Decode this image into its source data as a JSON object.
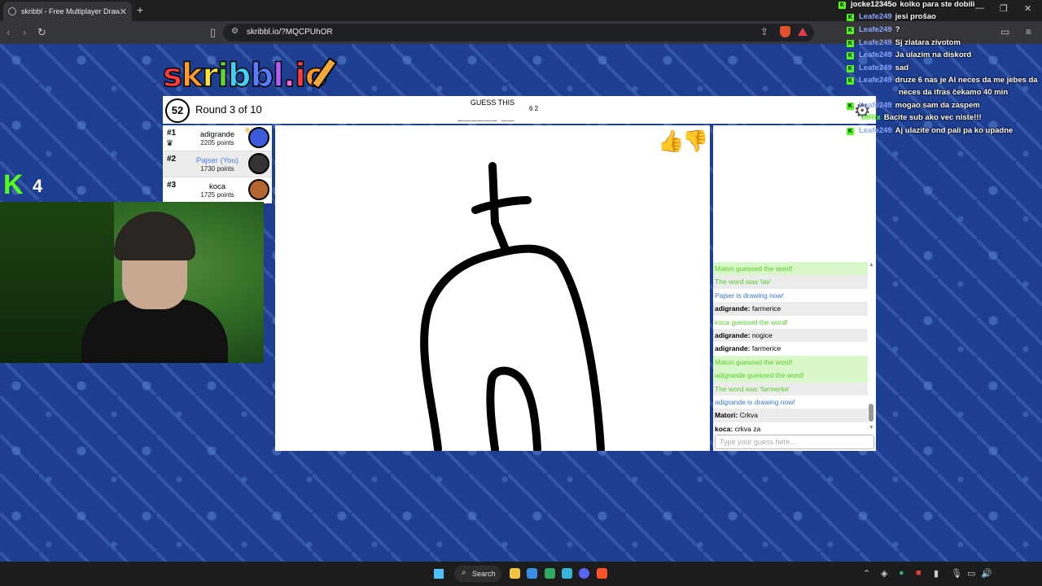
{
  "browser": {
    "tab_title": "skribbl - Free Multiplayer Drawing & Guessing Game",
    "url": "skribbl.io/?MQCPUhOR"
  },
  "game": {
    "logo_text": "skribbl.io",
    "timer": "52",
    "round_text": "Round 3 of 10",
    "guess_label": "GUESS THIS",
    "word_hint": "______  __",
    "word_lengths": "6 2",
    "players": [
      {
        "rank": "#1",
        "name": "adigrande",
        "points": "2205 points",
        "avatar_color": "#3b5bdb",
        "drawing": true,
        "you": false
      },
      {
        "rank": "#2",
        "name": "Pajser (You)",
        "points": "1730 points",
        "avatar_color": "#333333",
        "drawing": false,
        "you": true
      },
      {
        "rank": "#3",
        "name": "koca",
        "points": "1725 points",
        "avatar_color": "#b5652e",
        "drawing": false,
        "you": false
      }
    ]
  },
  "chat": {
    "messages": [
      {
        "type": "green",
        "user": "",
        "text": "Matori guessed the word!"
      },
      {
        "type": "green",
        "user": "",
        "text": "The word was 'lav'"
      },
      {
        "type": "blue",
        "user": "",
        "text": "Pajser is drawing now!"
      },
      {
        "type": "normal",
        "user": "adigrande:",
        "text": "farmerice"
      },
      {
        "type": "green",
        "user": "",
        "text": "koca guessed the word!"
      },
      {
        "type": "normal",
        "user": "adigrande:",
        "text": "nogice"
      },
      {
        "type": "normal",
        "user": "adigrande:",
        "text": "farmerice"
      },
      {
        "type": "green",
        "user": "",
        "text": "Matori guessed the word!"
      },
      {
        "type": "green",
        "user": "",
        "text": "adigrande guessed the word!"
      },
      {
        "type": "green",
        "user": "",
        "text": "The word was 'farmerke'"
      },
      {
        "type": "blue",
        "user": "",
        "text": "adigrande is drawing now!"
      },
      {
        "type": "normal",
        "user": "Matori:",
        "text": "Crkva"
      },
      {
        "type": "normal",
        "user": "koca:",
        "text": "crkva za"
      }
    ],
    "input_placeholder": "Type your guess here..."
  },
  "stream_overlay": {
    "viewer_count": "4",
    "lines": [
      {
        "user": "jocke12345o",
        "text": "kolko para ste dobili"
      },
      {
        "user": "Leafe249",
        "text": "jesi prošao"
      },
      {
        "user": "Leafe249",
        "text": "?"
      },
      {
        "user": "Leafe249",
        "text": "Sj zlatara zivotom"
      },
      {
        "user": "Leafe249",
        "text": "Ja ulazim na diskord"
      },
      {
        "user": "Leafe249",
        "text": "sad"
      },
      {
        "user": "Leafe249",
        "text": "druze 6 nas je Al neces da me jebes da"
      },
      {
        "user": "",
        "text": "neces da ifras čekamo 40 min"
      },
      {
        "user": "Leafe249",
        "text": "mogao sam da zaspem"
      },
      {
        "user": "otRix",
        "text": "Bacite sub ako vec niste!!!"
      },
      {
        "user": "Leafe249",
        "text": "Aj ulazite ond pali pa ko upadne"
      }
    ]
  },
  "taskbar": {
    "search_label": "Search"
  }
}
